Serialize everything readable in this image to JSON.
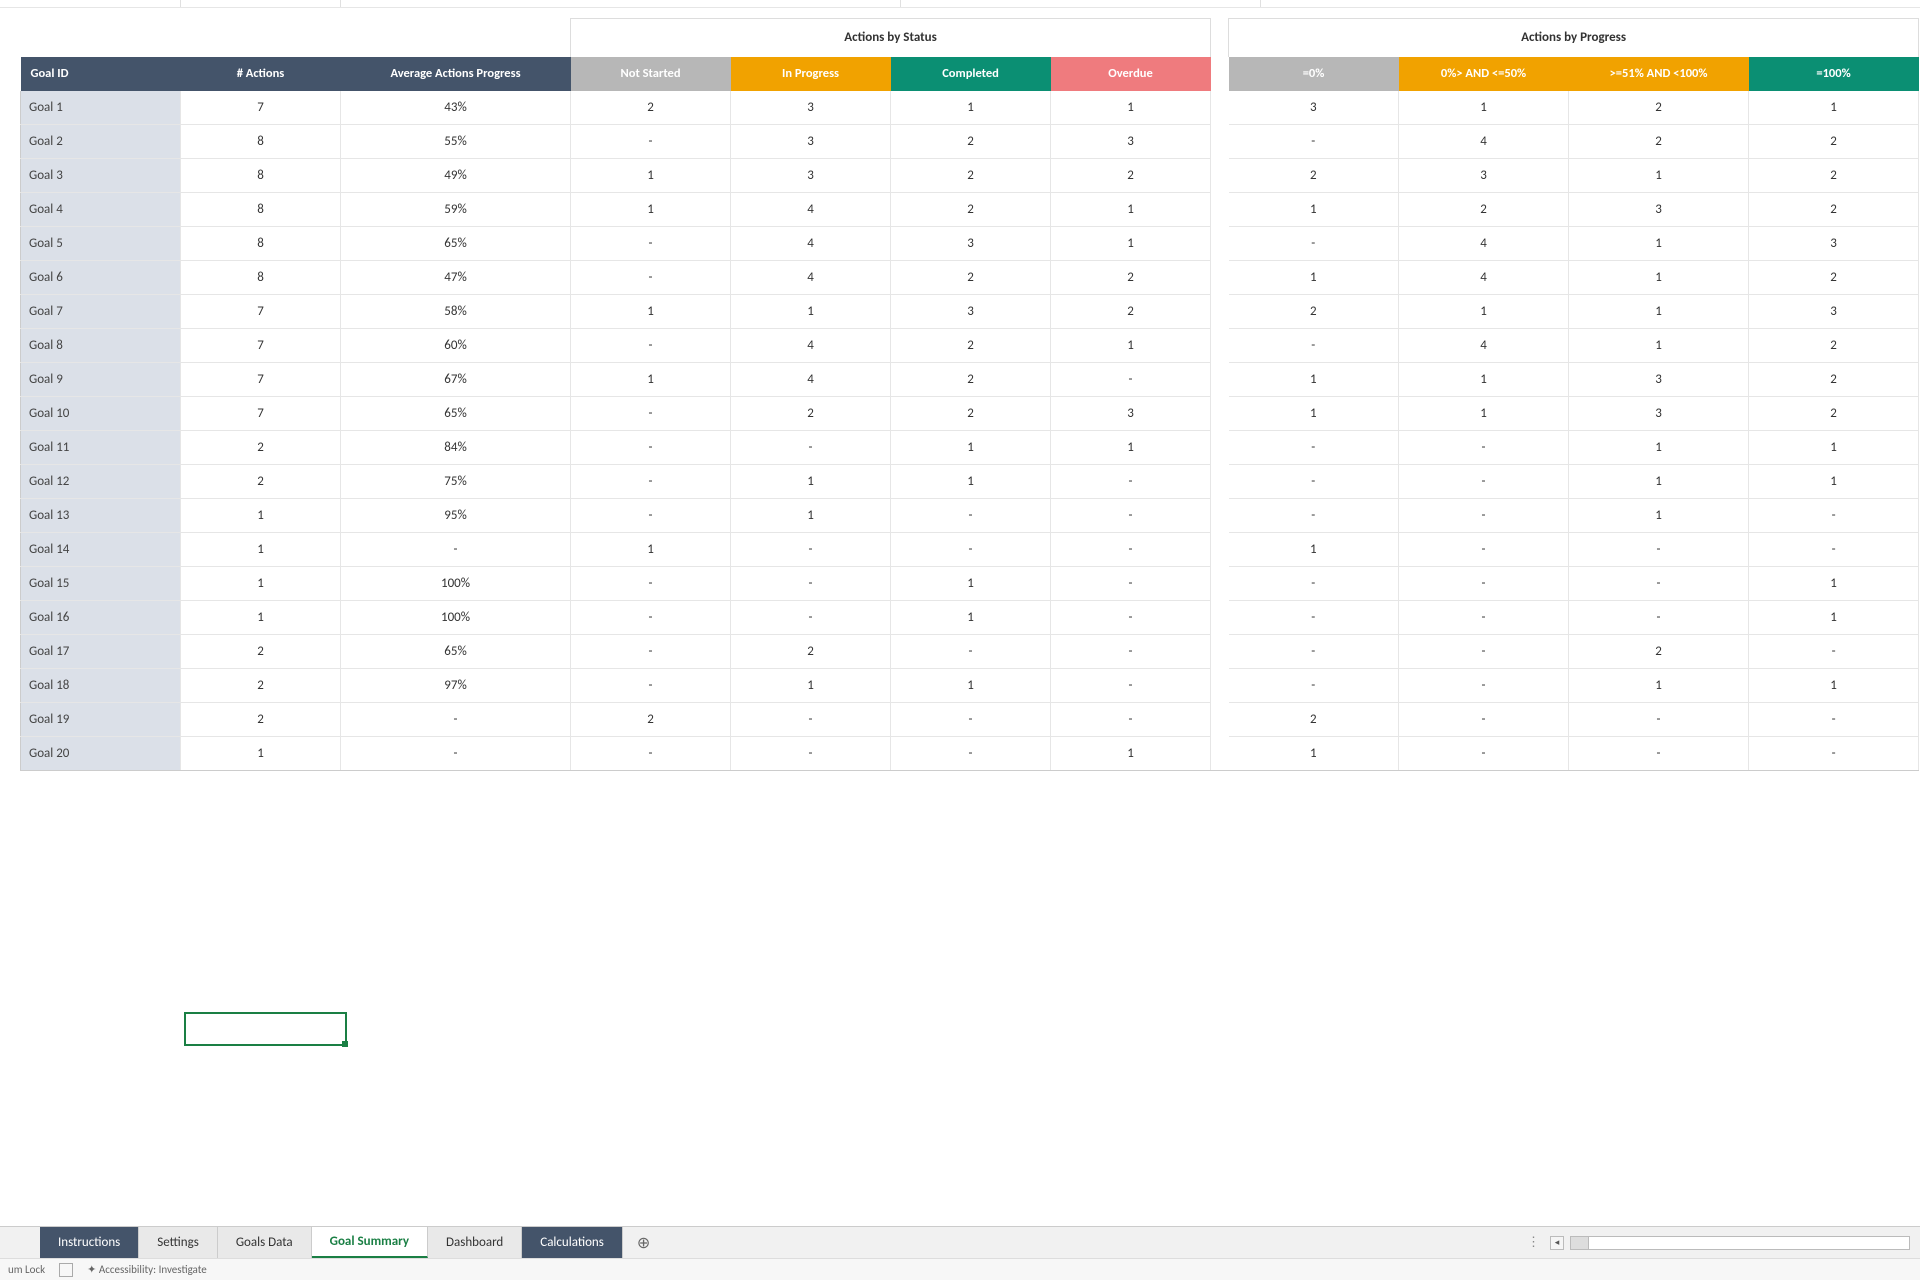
{
  "sheet": {
    "group_headers": {
      "status": "Actions by Status",
      "progress": "Actions by Progress"
    },
    "headers": {
      "goal": "Goal ID",
      "actions": "# Actions",
      "avg": "Average Actions Progress",
      "ns": "Not Started",
      "ip": "In Progress",
      "cmp": "Completed",
      "ovd": "Overdue",
      "p0": "=0%",
      "p1": "0%> AND <=50%",
      "p2": ">=51% AND <100%",
      "p3": "=100%"
    },
    "rows": [
      {
        "goal": "Goal 1",
        "actions": "7",
        "avg": "43%",
        "ns": "2",
        "ip": "3",
        "cmp": "1",
        "ovd": "1",
        "p0": "3",
        "p1": "1",
        "p2": "2",
        "p3": "1"
      },
      {
        "goal": "Goal 2",
        "actions": "8",
        "avg": "55%",
        "ns": "-",
        "ip": "3",
        "cmp": "2",
        "ovd": "3",
        "p0": "-",
        "p1": "4",
        "p2": "2",
        "p3": "2"
      },
      {
        "goal": "Goal 3",
        "actions": "8",
        "avg": "49%",
        "ns": "1",
        "ip": "3",
        "cmp": "2",
        "ovd": "2",
        "p0": "2",
        "p1": "3",
        "p2": "1",
        "p3": "2"
      },
      {
        "goal": "Goal 4",
        "actions": "8",
        "avg": "59%",
        "ns": "1",
        "ip": "4",
        "cmp": "2",
        "ovd": "1",
        "p0": "1",
        "p1": "2",
        "p2": "3",
        "p3": "2"
      },
      {
        "goal": "Goal 5",
        "actions": "8",
        "avg": "65%",
        "ns": "-",
        "ip": "4",
        "cmp": "3",
        "ovd": "1",
        "p0": "-",
        "p1": "4",
        "p2": "1",
        "p3": "3"
      },
      {
        "goal": "Goal 6",
        "actions": "8",
        "avg": "47%",
        "ns": "-",
        "ip": "4",
        "cmp": "2",
        "ovd": "2",
        "p0": "1",
        "p1": "4",
        "p2": "1",
        "p3": "2"
      },
      {
        "goal": "Goal 7",
        "actions": "7",
        "avg": "58%",
        "ns": "1",
        "ip": "1",
        "cmp": "3",
        "ovd": "2",
        "p0": "2",
        "p1": "1",
        "p2": "1",
        "p3": "3"
      },
      {
        "goal": "Goal 8",
        "actions": "7",
        "avg": "60%",
        "ns": "-",
        "ip": "4",
        "cmp": "2",
        "ovd": "1",
        "p0": "-",
        "p1": "4",
        "p2": "1",
        "p3": "2"
      },
      {
        "goal": "Goal 9",
        "actions": "7",
        "avg": "67%",
        "ns": "1",
        "ip": "4",
        "cmp": "2",
        "ovd": "-",
        "p0": "1",
        "p1": "1",
        "p2": "3",
        "p3": "2"
      },
      {
        "goal": "Goal 10",
        "actions": "7",
        "avg": "65%",
        "ns": "-",
        "ip": "2",
        "cmp": "2",
        "ovd": "3",
        "p0": "1",
        "p1": "1",
        "p2": "3",
        "p3": "2"
      },
      {
        "goal": "Goal 11",
        "actions": "2",
        "avg": "84%",
        "ns": "-",
        "ip": "-",
        "cmp": "1",
        "ovd": "1",
        "p0": "-",
        "p1": "-",
        "p2": "1",
        "p3": "1"
      },
      {
        "goal": "Goal 12",
        "actions": "2",
        "avg": "75%",
        "ns": "-",
        "ip": "1",
        "cmp": "1",
        "ovd": "-",
        "p0": "-",
        "p1": "-",
        "p2": "1",
        "p3": "1"
      },
      {
        "goal": "Goal 13",
        "actions": "1",
        "avg": "95%",
        "ns": "-",
        "ip": "1",
        "cmp": "-",
        "ovd": "-",
        "p0": "-",
        "p1": "-",
        "p2": "1",
        "p3": "-"
      },
      {
        "goal": "Goal 14",
        "actions": "1",
        "avg": "-",
        "ns": "1",
        "ip": "-",
        "cmp": "-",
        "ovd": "-",
        "p0": "1",
        "p1": "-",
        "p2": "-",
        "p3": "-"
      },
      {
        "goal": "Goal 15",
        "actions": "1",
        "avg": "100%",
        "ns": "-",
        "ip": "-",
        "cmp": "1",
        "ovd": "-",
        "p0": "-",
        "p1": "-",
        "p2": "-",
        "p3": "1"
      },
      {
        "goal": "Goal 16",
        "actions": "1",
        "avg": "100%",
        "ns": "-",
        "ip": "-",
        "cmp": "1",
        "ovd": "-",
        "p0": "-",
        "p1": "-",
        "p2": "-",
        "p3": "1"
      },
      {
        "goal": "Goal 17",
        "actions": "2",
        "avg": "65%",
        "ns": "-",
        "ip": "2",
        "cmp": "-",
        "ovd": "-",
        "p0": "-",
        "p1": "-",
        "p2": "2",
        "p3": "-"
      },
      {
        "goal": "Goal 18",
        "actions": "2",
        "avg": "97%",
        "ns": "-",
        "ip": "1",
        "cmp": "1",
        "ovd": "-",
        "p0": "-",
        "p1": "-",
        "p2": "1",
        "p3": "1"
      },
      {
        "goal": "Goal 19",
        "actions": "2",
        "avg": "-",
        "ns": "2",
        "ip": "-",
        "cmp": "-",
        "ovd": "-",
        "p0": "2",
        "p1": "-",
        "p2": "-",
        "p3": "-"
      },
      {
        "goal": "Goal 20",
        "actions": "1",
        "avg": "-",
        "ns": "-",
        "ip": "-",
        "cmp": "-",
        "ovd": "1",
        "p0": "1",
        "p1": "-",
        "p2": "-",
        "p3": "-"
      }
    ]
  },
  "tabs": {
    "items": [
      {
        "label": "Instructions",
        "style": "dark"
      },
      {
        "label": "Settings",
        "style": "light"
      },
      {
        "label": "Goals Data",
        "style": "light"
      },
      {
        "label": "Goal Summary",
        "style": "active"
      },
      {
        "label": "Dashboard",
        "style": "light"
      },
      {
        "label": "Calculations",
        "style": "dark"
      }
    ],
    "add": "⊕"
  },
  "statusbar": {
    "numlock": "um Lock",
    "accessibility": "Accessibility: Investigate"
  }
}
